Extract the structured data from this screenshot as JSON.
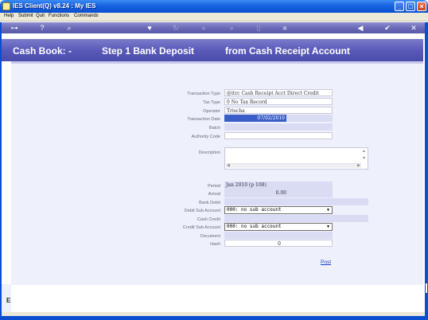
{
  "window": {
    "title": "IES Client(Q) v8.24 : My IES",
    "minimize_glyph": "_",
    "maximize_glyph": "□",
    "close_glyph": "×"
  },
  "menu": {
    "items": [
      "Help",
      "Submit",
      "Quit",
      "Functions",
      "Commands"
    ]
  },
  "toolbar": {
    "icons": [
      "key-icon",
      "help-icon",
      "search-icon",
      "heart-icon",
      "refresh-icon",
      "rewind-icon",
      "fast-forward-icon",
      "document-icon",
      "stop-icon",
      "back-icon",
      "check-icon",
      "close-icon"
    ],
    "glyphs": {
      "key": "⊶",
      "help": "?",
      "search": "⌕",
      "heart": "♥",
      "refresh": "↻",
      "rewind": "«",
      "forward": "»",
      "document": "▯",
      "stop": "■",
      "back": "◀",
      "check": "✔",
      "close": "✕"
    }
  },
  "header": {
    "part1": "Cash Book: -",
    "part2": "Step 1 Bank Deposit",
    "part3": "from Cash Receipt Account"
  },
  "form": {
    "transaction_type": {
      "label": "Transaction Type",
      "value": "@itrc Cash Receipt Acct Direct Credit"
    },
    "tax_type": {
      "label": "Tax Type",
      "value": "0 No Tax Record"
    },
    "operator": {
      "label": "Operator",
      "value": "Trischa"
    },
    "transaction_date": {
      "label": "Transaction Date",
      "value": "07/02/2010"
    },
    "batch": {
      "label": "Batch",
      "value": ""
    },
    "authority_code": {
      "label": "Authority Code",
      "value": ""
    },
    "description": {
      "label": "Description",
      "value": ""
    },
    "period": {
      "label": "Period",
      "value": "Jan 2010 (p 108)"
    },
    "actual": {
      "label": "Actual",
      "value": "0.00"
    },
    "bank_debit": {
      "label": "Bank Debit",
      "value": ""
    },
    "debit_sub_account": {
      "label": "Debit Sub Account",
      "value": "000: no sub account"
    },
    "cash_credit": {
      "label": "Cash Credit",
      "value": ""
    },
    "credit_sub_account": {
      "label": "Credit Sub Account",
      "value": "000: no sub account"
    },
    "document": {
      "label": "Document",
      "value": ""
    },
    "hash": {
      "label": "Hash",
      "value": "0"
    }
  },
  "actions": {
    "post_label": "Post"
  },
  "side": {
    "left_icon": "E"
  },
  "colors": {
    "titlebar": "#1763e0",
    "toolbar": "#6a6ab8",
    "header": "#5a5aba",
    "field": "#dadcf4",
    "selected_field": "#3a5ec8",
    "link": "#2040c0"
  }
}
